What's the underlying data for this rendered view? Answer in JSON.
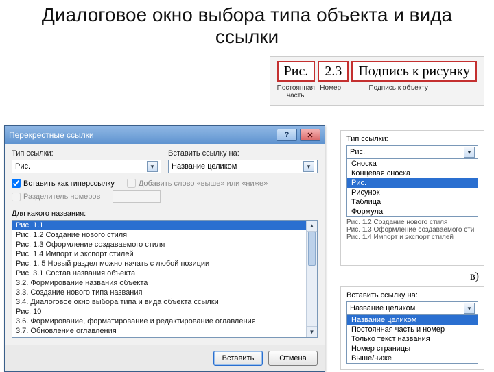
{
  "slide_title": "Диалоговое окно выбора типа объекта и вида ссылки",
  "caption_demo": {
    "const_part": "Рис.",
    "number": "2.3",
    "caption": "Подпись к рисунку",
    "labels": [
      "Постоянная часть",
      "Номер",
      "Подпись к объекту"
    ]
  },
  "dialog": {
    "title": "Перекрестные ссылки",
    "type_label": "Тип ссылки:",
    "type_value": "Рис.",
    "insert_on_label": "Вставить ссылку на:",
    "insert_on_value": "Название целиком",
    "check_hyperlink": "Вставить как гиперссылку",
    "check_add_above": "Добавить слово «выше» или «ниже»",
    "check_separator": "Разделитель номеров",
    "for_which_label": "Для какого названия:",
    "items": [
      "Рис. 1.1",
      "Рис. 1.2 Создание нового стиля",
      "Рис. 1.3 Оформление создаваемого стиля",
      "Рис. 1.4 Импорт и экспорт стилей",
      "Рис. 1. 5 Новый раздел можно начать с любой позиции",
      "Рис. 3.1 Состав названия объекта",
      "3.2. Формирование названия объекта",
      "3.3. Создание нового типа названия",
      "3.4. Диалоговое окно выбора типа и вида объекта ссылки",
      "Рис. 10",
      "3.6. Формирование, форматирование и редактирование оглавления",
      "3.7. Обновление оглавления"
    ],
    "selected_item_index": 0,
    "btn_insert": "Вставить",
    "btn_cancel": "Отмена"
  },
  "type_panel": {
    "label": "Тип ссылки:",
    "selected": "Рис.",
    "options": [
      "Сноска",
      "Концевая сноска",
      "Рис.",
      "Рисунок",
      "Таблица",
      "Формула"
    ],
    "below": [
      "Рис. 1.2 Создание нового стиля",
      "Рис. 1.3 Оформление создаваемого сти",
      "Рис. 1.4 Импорт и экспорт стилей"
    ]
  },
  "subfigure_label": "в)",
  "insert_panel": {
    "label": "Вставить ссылку на:",
    "selected": "Название целиком",
    "options": [
      "Название целиком",
      "Постоянная часть и номер",
      "Только текст названия",
      "Номер страницы",
      "Выше/ниже"
    ]
  }
}
